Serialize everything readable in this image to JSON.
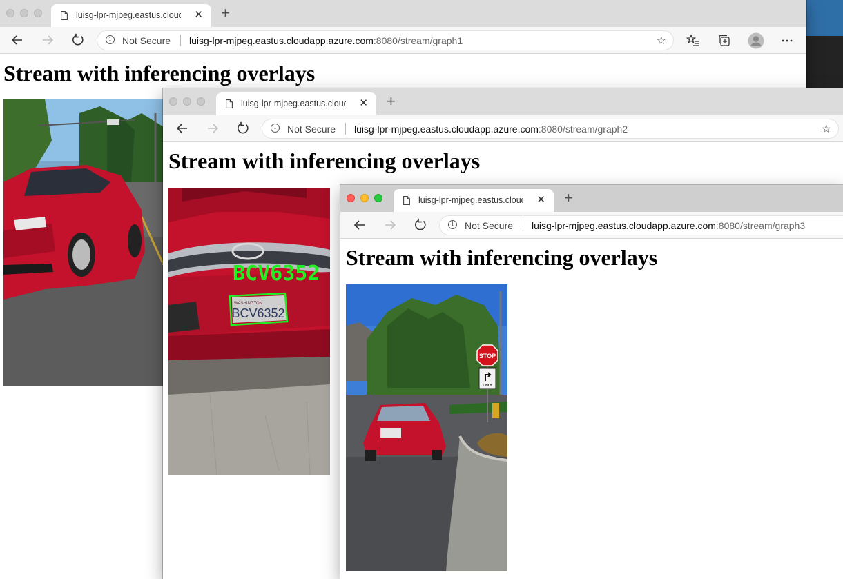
{
  "tab_title": "luisg-lpr-mjpeg.eastus.cloudapp.azure.com",
  "security_label": "Not Secure",
  "url_host": "luisg-lpr-mjpeg.eastus.cloudapp.azure.com",
  "windows": [
    {
      "url_rest": ":8080/stream/graph1",
      "heading": "Stream with inferencing overlays"
    },
    {
      "url_rest": ":8080/stream/graph2",
      "heading": "Stream with inferencing overlays",
      "overlay_text": "BCV6352",
      "plate_text": "BCV6352"
    },
    {
      "url_rest": ":8080/stream/graph3",
      "heading": "Stream with inferencing overlays",
      "sign_stop": "STOP",
      "sign_only": "ONLY"
    }
  ],
  "colors": {
    "overlay": "#22ee22",
    "car_red": "#c4112c"
  }
}
